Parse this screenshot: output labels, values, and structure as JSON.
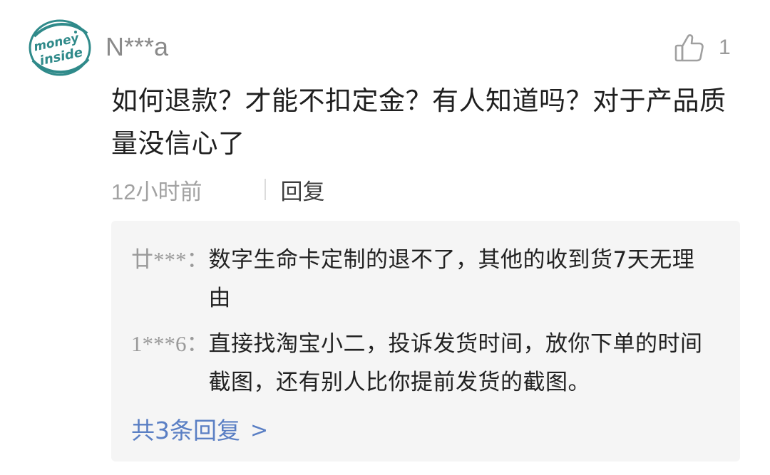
{
  "comment": {
    "avatar_text_line1": "money",
    "avatar_text_line2": "inside",
    "username": "N***a",
    "like_count": "1",
    "text": "如何退款？才能不扣定金？有人知道吗？对于产品质量没信心了",
    "time": "12小时前",
    "reply_label": "回复"
  },
  "replies": {
    "items": [
      {
        "name": "廿***：",
        "text": "数字生命卡定制的退不了，其他的收到货7天无理由"
      },
      {
        "name": "1***6：",
        "text": "直接找淘宝小二，投诉发货时间，放你下单的时间截图，还有别人比你提前发货的截图。"
      }
    ],
    "more_label": "共3条回复",
    "more_arrow": ">"
  },
  "colors": {
    "accent_link": "#5a7fc4",
    "avatar_green": "#2f8a8a",
    "reply_bg": "#f5f5f5"
  }
}
